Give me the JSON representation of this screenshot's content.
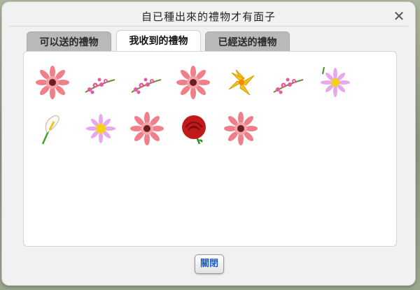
{
  "dialog": {
    "title": "自已種出來的禮物才有面子",
    "close_symbol": "✕",
    "close_button_label": "關閉"
  },
  "tabs": [
    {
      "label": "可以送的禮物",
      "active": false
    },
    {
      "label": "我收到的禮物",
      "active": true
    },
    {
      "label": "已經送的禮物",
      "active": false
    }
  ],
  "gifts": [
    {
      "icon": "pink-gerbera-icon"
    },
    {
      "icon": "cherry-blossom-branch-icon"
    },
    {
      "icon": "cherry-blossom-branch-icon"
    },
    {
      "icon": "pink-gerbera-icon"
    },
    {
      "icon": "yellow-lily-icon"
    },
    {
      "icon": "cherry-blossom-branch-icon"
    },
    {
      "icon": "purple-daisy-icon"
    },
    {
      "icon": "calla-lily-icon"
    },
    {
      "icon": "purple-daisy-icon"
    },
    {
      "icon": "pink-gerbera-icon"
    },
    {
      "icon": "red-rose-icon"
    },
    {
      "icon": "pink-gerbera-icon"
    }
  ],
  "colors": {
    "accent": "#1f5fb8",
    "tab_inactive": "#b9b9b9",
    "panel": "#ffffff"
  }
}
